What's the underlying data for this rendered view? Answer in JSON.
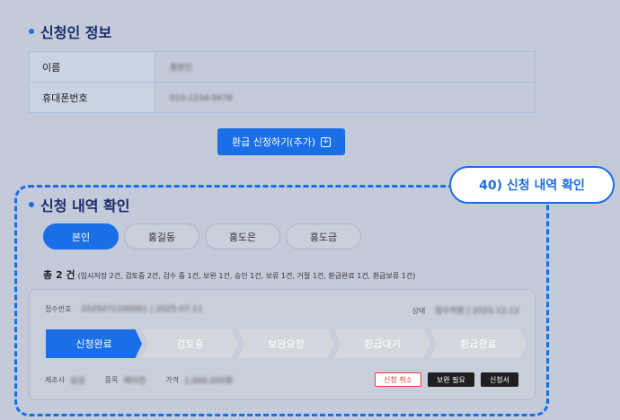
{
  "applicant": {
    "title": "신청인 정보",
    "rows": [
      {
        "label": "이름",
        "value": "홍본인"
      },
      {
        "label": "휴대폰번호",
        "value": "010-1234-5678"
      }
    ]
  },
  "add_button": {
    "label": "환급 신청하기(추가)",
    "icon": "+"
  },
  "callout": {
    "label": "40) 신청 내역 확인"
  },
  "history": {
    "title": "신청 내역 확인",
    "tabs": [
      "본인",
      "홍길동",
      "홍도은",
      "홍도금"
    ],
    "active_tab": 0,
    "summary_total": "총 2 건",
    "summary_detail": "(임시저장 2건, 검토중 2건, 검수 중 1건, 보완 1건, 승인 1건, 보류 1건, 거절 1건, 환급완료 1건, 환급보류 1건)"
  },
  "card": {
    "receipt_label": "접수번호",
    "receipt_value": "2025071100001 | 2025-07-11",
    "status_label": "상태",
    "status_value": "접수처분 | 2025-12-12",
    "steps": [
      "신청완료",
      "검토중",
      "보완요청",
      "환급대기",
      "환급완료"
    ],
    "active_step": 0,
    "maker_label": "제조사",
    "maker_value": "삼성",
    "item_label": "품목",
    "item_value": "에어컨",
    "price_label": "가격",
    "price_value": "1,000,000원",
    "actions": {
      "cancel": "신청 취소",
      "supplement": "보완 필요",
      "application": "신청서"
    }
  },
  "colors": {
    "accent": "#1a6ee8",
    "background": "#c3cad9",
    "cancel": "#e23c3c"
  }
}
